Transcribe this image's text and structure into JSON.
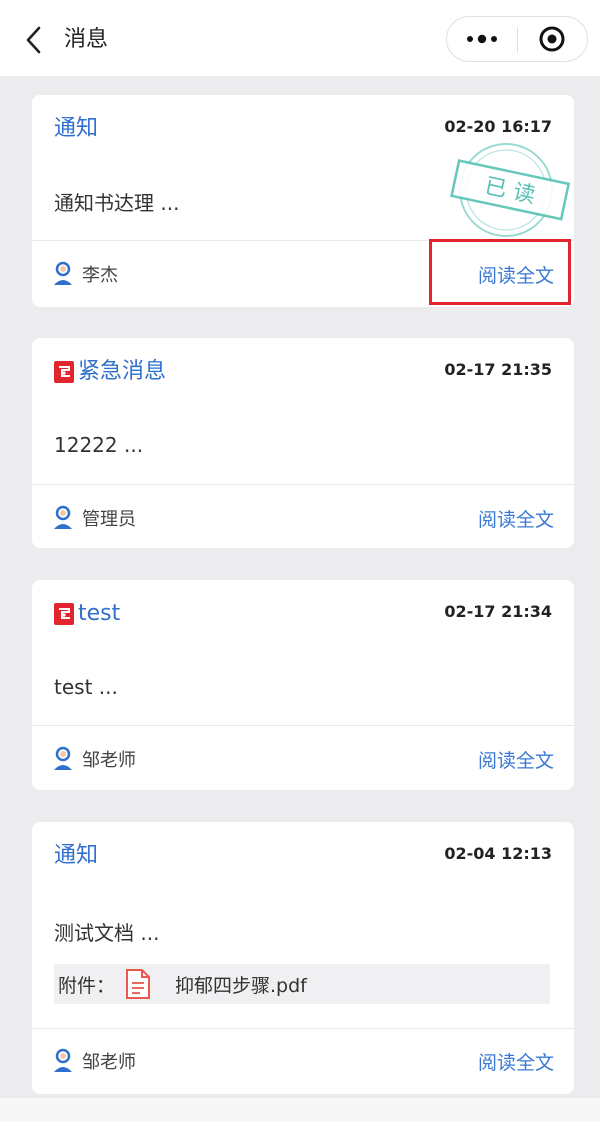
{
  "nav": {
    "title": "消息",
    "back_icon": "chevron-left-icon",
    "more_icon": "more-dots-icon",
    "close_icon": "target-circle-icon"
  },
  "colors": {
    "accent": "#2f6fce",
    "link": "#3a78d4",
    "urgent": "#e3262d",
    "stamp": "#56c1b4",
    "highlight": "#e0262d"
  },
  "messages": [
    {
      "title": "通知",
      "time": "02-20 16:17",
      "body": "通知书达理 ...",
      "author": "李杰",
      "read_label": "阅读全文",
      "read_stamp": "已 读",
      "highlighted": true
    },
    {
      "title": "紧急消息",
      "time": "02-17 21:35",
      "body": "12222 ...",
      "author": "管理员",
      "read_label": "阅读全文",
      "urgent": true
    },
    {
      "title": "test",
      "time": "02-17 21:34",
      "body": "test ...",
      "author": "邹老师",
      "read_label": "阅读全文",
      "urgent": true
    },
    {
      "title": "通知",
      "time": "02-04 12:13",
      "body": "测试文档 ...",
      "attachment_label": "附件：",
      "attachment_name": "抑郁四步骤.pdf",
      "author": "邹老师",
      "read_label": "阅读全文"
    }
  ]
}
